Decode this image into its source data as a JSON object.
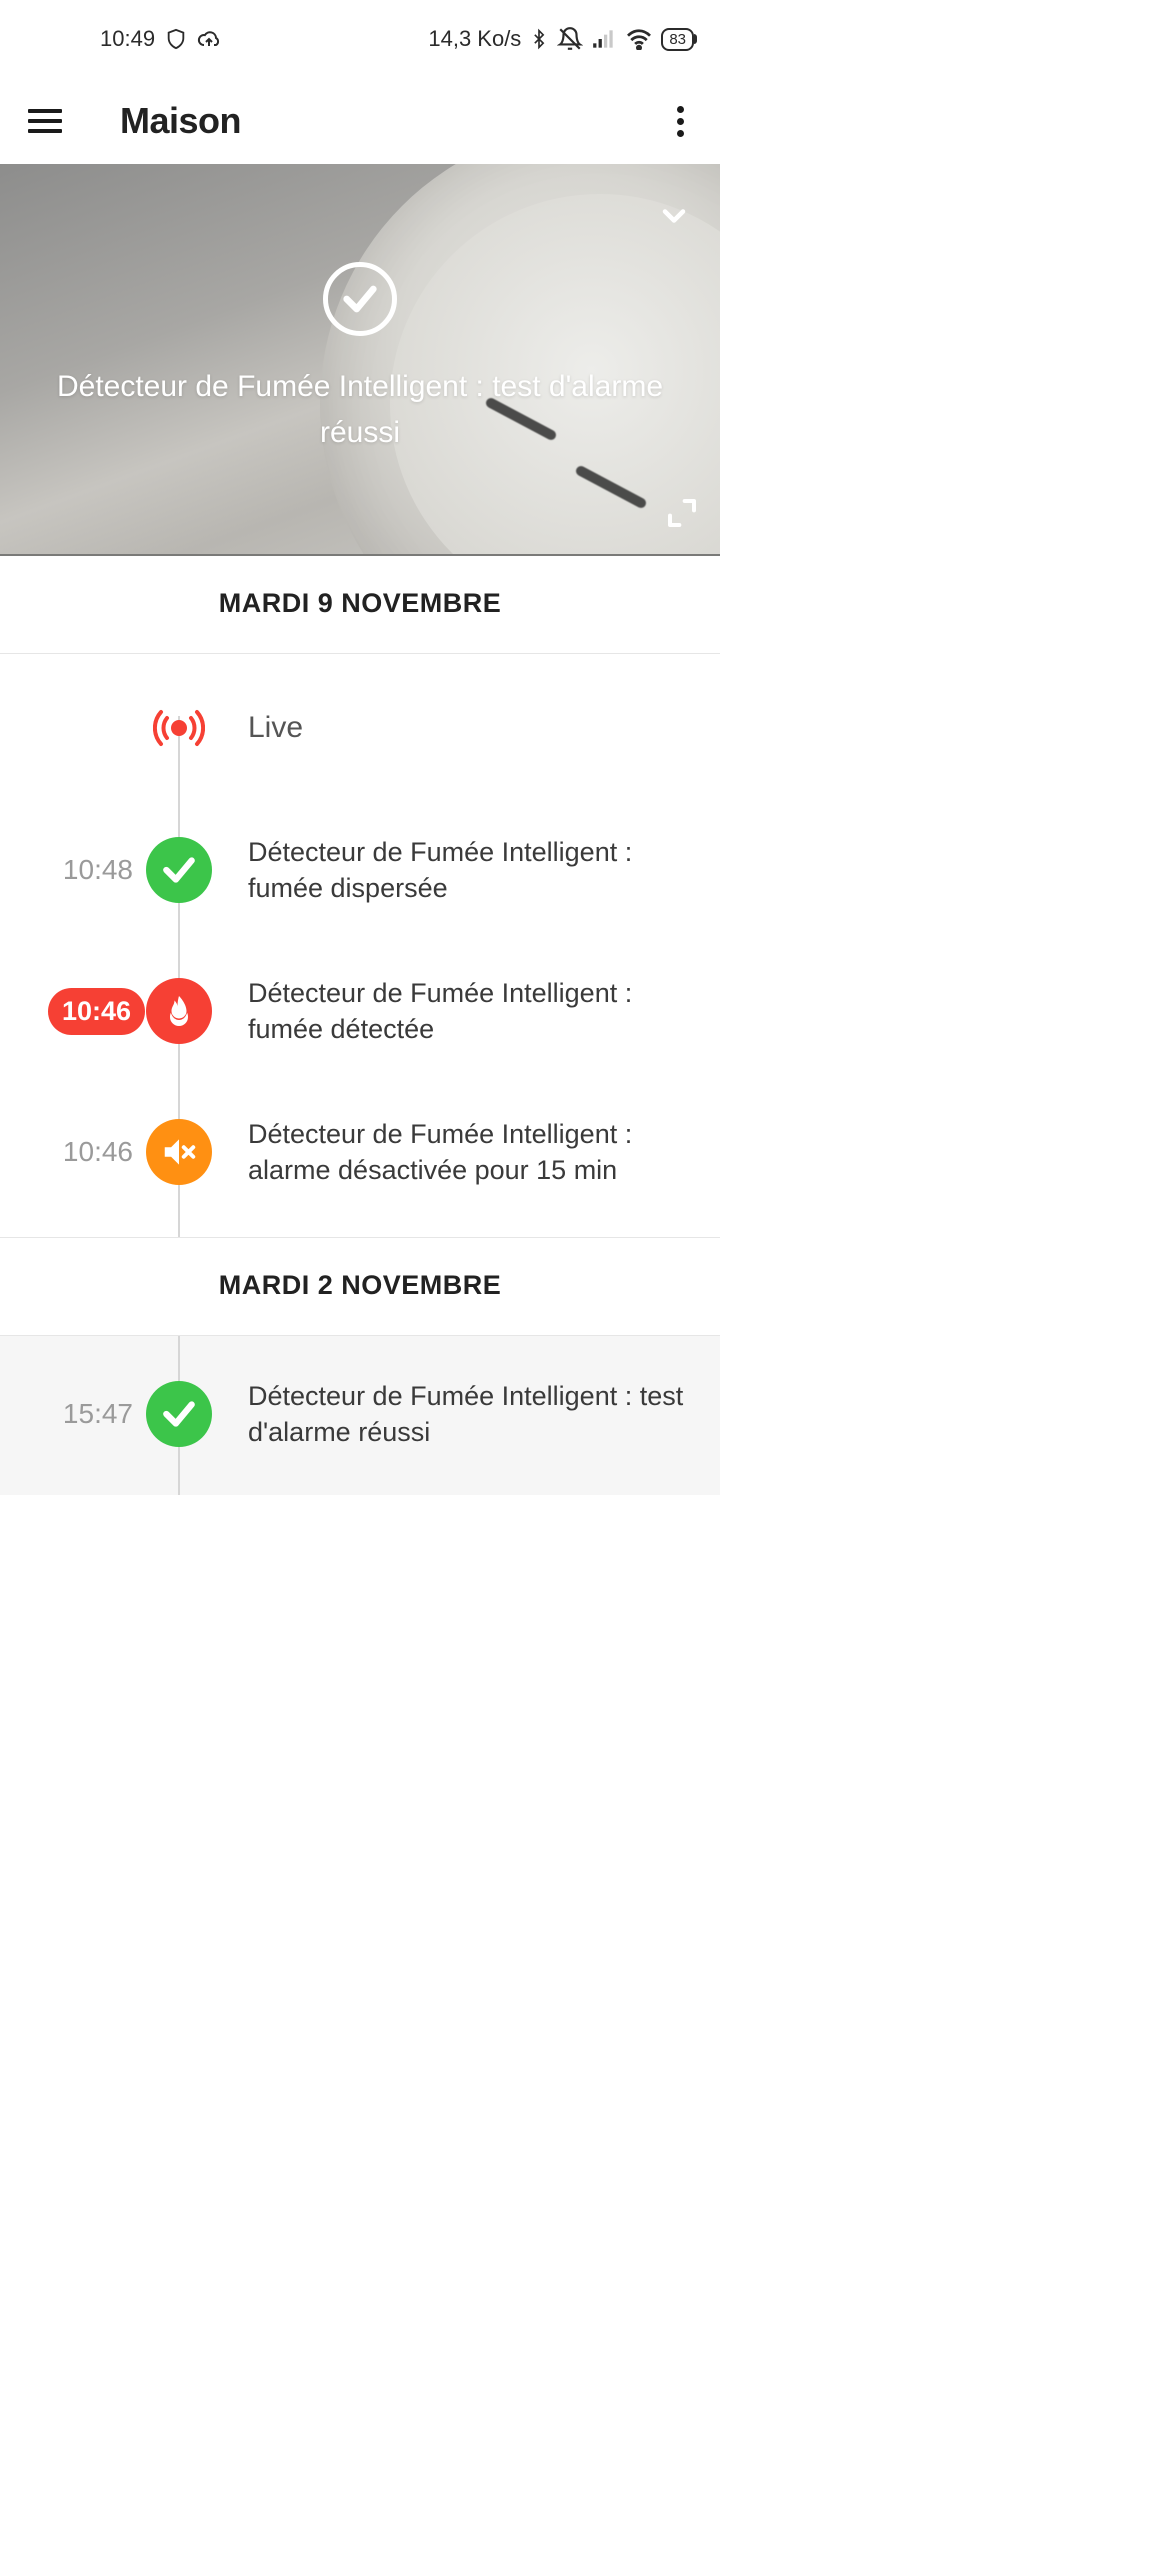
{
  "status_bar": {
    "time": "10:49",
    "net_speed": "14,3 Ko/s",
    "battery": "83"
  },
  "app_bar": {
    "title": "Maison"
  },
  "hero": {
    "message": "Détecteur de Fumée Intelligent : test d'alarme réussi"
  },
  "sections": [
    {
      "date": "MARDI 9 NOVEMBRE",
      "events": [
        {
          "type": "live",
          "label": "Live"
        },
        {
          "type": "ok",
          "time": "10:48",
          "highlight": false,
          "text": "Détecteur de Fumée Intelligent : fumée dispersée"
        },
        {
          "type": "alert",
          "time": "10:46",
          "highlight": true,
          "text": "Détecteur de Fumée Intelligent : fumée détectée"
        },
        {
          "type": "mute",
          "time": "10:46",
          "highlight": false,
          "text": "Détecteur de Fumée Intelligent : alarme désactivée pour 15 min"
        }
      ]
    },
    {
      "date": "MARDI 2 NOVEMBRE",
      "events": [
        {
          "type": "ok",
          "time": "15:47",
          "highlight": false,
          "text": "Détecteur de Fumée Intelligent : test d'alarme réussi"
        }
      ]
    }
  ],
  "colors": {
    "ok": "#3cc54a",
    "alert": "#f64034",
    "mute": "#ff9012"
  }
}
